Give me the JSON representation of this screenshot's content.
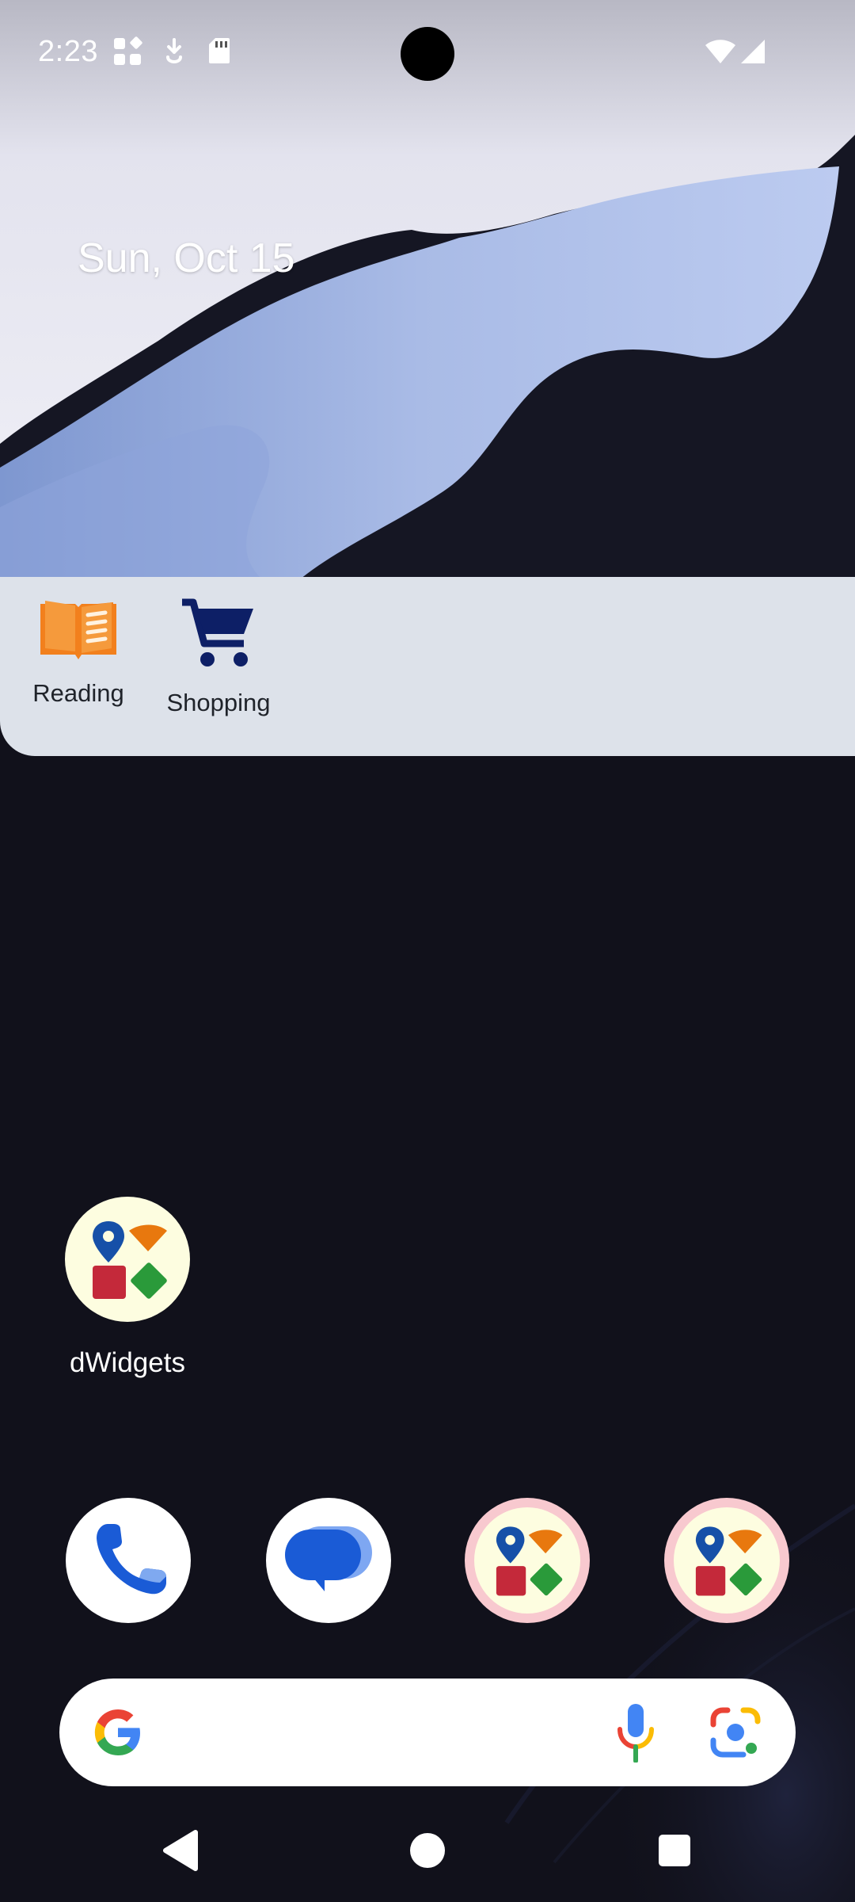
{
  "status_bar": {
    "time": "2:23",
    "icons": [
      "smartspace-icon",
      "cloud-download-icon",
      "sd-card-icon",
      "wifi-icon",
      "signal-icon"
    ]
  },
  "date": "Sun, Oct 15",
  "widget": {
    "items": [
      {
        "label": "Reading",
        "icon": "book-icon"
      },
      {
        "label": "Shopping",
        "icon": "cart-icon"
      }
    ]
  },
  "apps": {
    "dwidgets": {
      "label": "dWidgets",
      "icon": "dwidgets-icon"
    }
  },
  "dock": [
    {
      "name": "phone",
      "icon": "phone-icon"
    },
    {
      "name": "messages",
      "icon": "messages-icon"
    },
    {
      "name": "dwidgets",
      "icon": "dwidgets-icon"
    },
    {
      "name": "dwidgets",
      "icon": "dwidgets-icon"
    }
  ],
  "search": {
    "icons": [
      "google-g-icon",
      "mic-icon",
      "lens-icon"
    ]
  },
  "nav": [
    "back-icon",
    "home-icon",
    "recents-icon"
  ],
  "colors": {
    "widget_bg": "#dde2ea",
    "book_orange": "#f2801d",
    "cart_navy": "#0d1f66",
    "dwidgets_bg": "#fdfde0",
    "dwidgets_ring": "#f8c9cf"
  }
}
